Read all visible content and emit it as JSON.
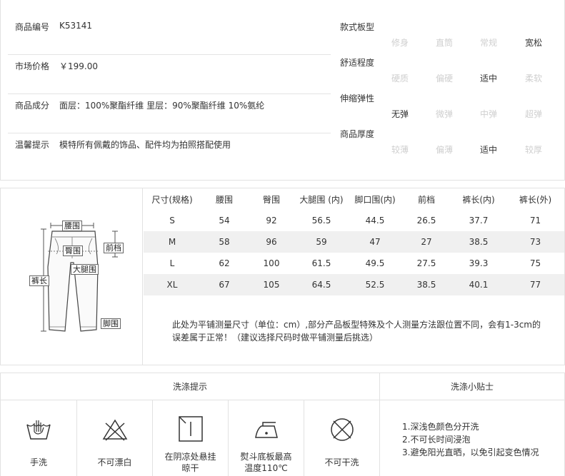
{
  "product_info": {
    "rows": [
      {
        "label": "商品编号",
        "value": "K53141"
      },
      {
        "label": "市场价格",
        "value": "￥199.00"
      },
      {
        "label": "商品成分",
        "value": "面层：100%聚酯纤维 里层：90%聚酯纤维 10%氨纶"
      },
      {
        "label": "温馨提示",
        "value": "模特所有佩戴的饰品、配件均为拍照搭配使用"
      }
    ],
    "attributes": [
      {
        "label": "款式板型",
        "options": [
          "修身",
          "直筒",
          "常规",
          "宽松"
        ],
        "selected": 3
      },
      {
        "label": "舒适程度",
        "options": [
          "硬质",
          "偏硬",
          "适中",
          "柔软"
        ],
        "selected": 2
      },
      {
        "label": "伸缩弹性",
        "options": [
          "无弹",
          "微弹",
          "中弹",
          "超弹"
        ],
        "selected": 0
      },
      {
        "label": "商品厚度",
        "options": [
          "较薄",
          "偏薄",
          "适中",
          "较厚"
        ],
        "selected": 2
      }
    ]
  },
  "size_chart": {
    "diagram_labels": {
      "waist": "腰围",
      "hip": "臀围",
      "front_rise": "前档",
      "thigh": "大腿围",
      "length": "裤长",
      "hem": "脚围"
    },
    "headers": [
      "尺寸(规格)",
      "腰围",
      "臀围",
      "大腿围 (内)",
      "脚口围(内)",
      "前档",
      "裤长(内)",
      "裤长(外)"
    ],
    "rows": [
      [
        "S",
        "54",
        "92",
        "56.5",
        "44.5",
        "26.5",
        "37.7",
        "71"
      ],
      [
        "M",
        "58",
        "96",
        "59",
        "47",
        "27",
        "38.5",
        "73"
      ],
      [
        "L",
        "62",
        "100",
        "61.5",
        "49.5",
        "27.5",
        "39.3",
        "75"
      ],
      [
        "XL",
        "67",
        "105",
        "64.5",
        "52.5",
        "38.5",
        "40.1",
        "77"
      ]
    ],
    "note_line1": "此处为平铺测量尺寸（单位：cm）,部分产品板型特殊及个人测量方法跟位置不同，会有1-3cm的",
    "note_line2": "误差属于正常！（建议选择尺码时做平铺测量后挑选）"
  },
  "wash": {
    "title": "洗涤提示",
    "tips_title": "洗涤小贴士",
    "items": [
      {
        "icon": "hand-wash-icon",
        "caption": "手洗"
      },
      {
        "icon": "no-bleach-icon",
        "caption": "不可漂白"
      },
      {
        "icon": "hang-dry-shade-icon",
        "caption_line1": "在阴凉处悬挂",
        "caption_line2": "晾干"
      },
      {
        "icon": "iron-110-icon",
        "caption_line1": "熨斗底板最高",
        "caption_line2": "温度110℃"
      },
      {
        "icon": "no-dry-clean-icon",
        "caption": "不可干洗"
      }
    ],
    "tips": [
      "1.深浅色颜色分开洗",
      "2.不可长时间浸泡",
      "3.避免阳光直晒，以免引起变色情况"
    ]
  }
}
